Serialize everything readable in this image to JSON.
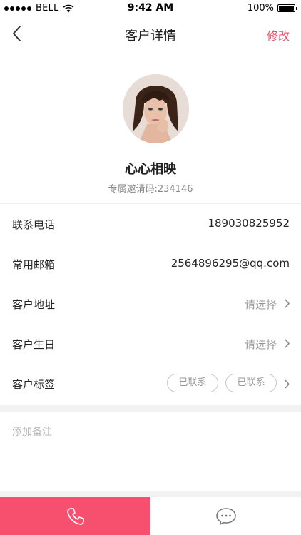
{
  "status_bar": {
    "carrier": "BELL",
    "time": "9:42 AM",
    "battery": "100%",
    "battery_level": 1.0
  },
  "nav": {
    "title": "客户详情",
    "edit_label": "修改",
    "back_icon": "chevron-left-icon"
  },
  "profile": {
    "name": "心心相映",
    "invite_code": "专属邀请码:234146"
  },
  "fields": [
    {
      "label": "联系电话",
      "value": "189030825952"
    },
    {
      "label": "常用邮箱",
      "value": "2564896295@qq.com"
    },
    {
      "label": "客户地址",
      "value": "请选择"
    },
    {
      "label": "客户生日",
      "value": "请选择"
    },
    {
      "label": "客户标签",
      "tags": [
        "已联系",
        "已联系"
      ]
    }
  ],
  "remark": {
    "placeholder": "添加备注"
  },
  "bottom_bar": {
    "call_icon": "phone-icon",
    "message_icon": "chat-bubble-icon"
  },
  "colors": {
    "accent": "#f6506e",
    "edit": "#f0506e"
  }
}
